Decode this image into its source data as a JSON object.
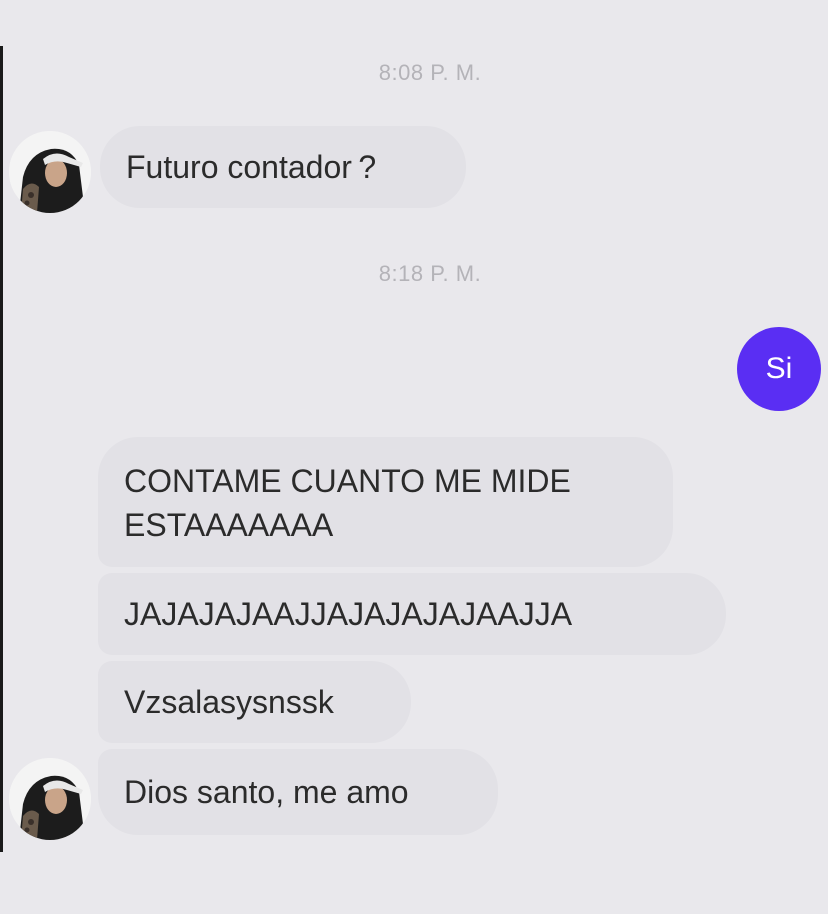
{
  "conversation": {
    "timestamps": [
      "8:08 P. M.",
      "8:18 P. M."
    ],
    "messages": {
      "futuro": "Futuro contador ?",
      "si": "Si",
      "contame": "CONTAME CUANTO ME MIDE ESTAAAAAAA",
      "jaja": "JAJAJAJAAJJAJAJAJAJAAJJA",
      "vzs": "Vzsalasysnssk",
      "dios": "Dios santo, me amo"
    },
    "colors": {
      "background": "#e9e8ec",
      "incoming_bubble": "#e2e1e6",
      "outgoing_bubble": "#5a2ef3",
      "timestamp": "#b4b3b8"
    },
    "avatar_icon": "user-avatar-hooded-person"
  }
}
